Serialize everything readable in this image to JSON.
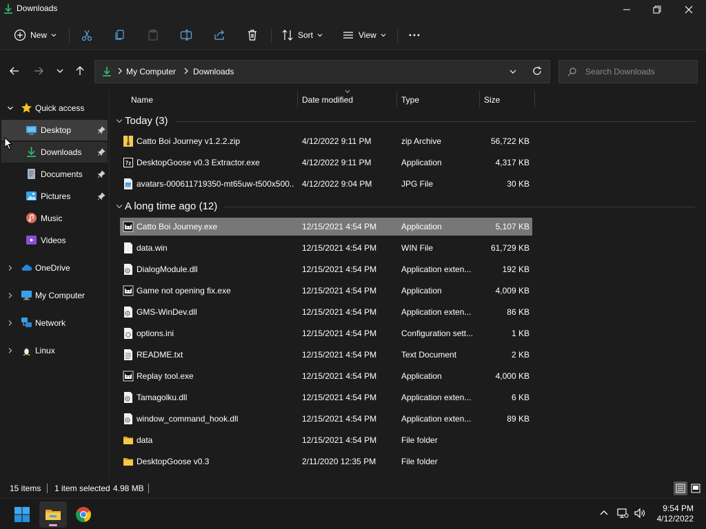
{
  "window": {
    "title": "Downloads",
    "icon": "download-arrow-icon",
    "controls": [
      "minimize-icon",
      "restore-icon",
      "close-icon"
    ]
  },
  "commandbar": {
    "new_label": "New",
    "sort_label": "Sort",
    "view_label": "View",
    "icons": [
      "cut-icon",
      "copy-icon",
      "paste-icon",
      "rename-icon",
      "share-icon",
      "delete-icon",
      "more-icon"
    ]
  },
  "address": {
    "crumbs": [
      "My Computer",
      "Downloads"
    ],
    "search_placeholder": "Search Downloads"
  },
  "sidebar": {
    "items": [
      {
        "label": "Quick access",
        "icon": "star-icon"
      },
      {
        "label": "Desktop",
        "icon": "desktop-icon",
        "pinned": true
      },
      {
        "label": "Downloads",
        "icon": "downloads-icon",
        "pinned": true
      },
      {
        "label": "Documents",
        "icon": "documents-icon",
        "pinned": true
      },
      {
        "label": "Pictures",
        "icon": "pictures-icon",
        "pinned": true
      },
      {
        "label": "Music",
        "icon": "music-icon"
      },
      {
        "label": "Videos",
        "icon": "videos-icon"
      },
      {
        "label": "OneDrive",
        "icon": "cloud-icon"
      },
      {
        "label": "My Computer",
        "icon": "monitor-icon"
      },
      {
        "label": "Network",
        "icon": "network-icon"
      },
      {
        "label": "Linux",
        "icon": "penguin-icon"
      }
    ]
  },
  "columns": {
    "name": "Name",
    "date": "Date modified",
    "type": "Type",
    "size": "Size"
  },
  "groups": [
    {
      "label": "Today (3)",
      "files": [
        {
          "name": "Catto Boi Journey v1.2.2.zip",
          "date": "4/12/2022 9:11 PM",
          "type": "zip Archive",
          "size": "56,722 KB",
          "icon": "zip-icon"
        },
        {
          "name": "DesktopGoose v0.3 Extractor.exe",
          "date": "4/12/2022 9:11 PM",
          "type": "Application",
          "size": "4,317 KB",
          "icon": "7z-icon"
        },
        {
          "name": "avatars-000611719350-mt65uw-t500x500....",
          "date": "4/12/2022 9:04 PM",
          "type": "JPG File",
          "size": "30 KB",
          "icon": "image-file-icon"
        }
      ]
    },
    {
      "label": "A long time ago (12)",
      "files": [
        {
          "name": "Catto Boi Journey.exe",
          "date": "12/15/2021 4:54 PM",
          "type": "Application",
          "size": "5,107 KB",
          "icon": "cat-app-icon",
          "selected": true
        },
        {
          "name": "data.win",
          "date": "12/15/2021 4:54 PM",
          "type": "WIN File",
          "size": "61,729 KB",
          "icon": "blank-file-icon"
        },
        {
          "name": "DialogModule.dll",
          "date": "12/15/2021 4:54 PM",
          "type": "Application exten...",
          "size": "192 KB",
          "icon": "dll-file-icon"
        },
        {
          "name": "Game not opening fix.exe",
          "date": "12/15/2021 4:54 PM",
          "type": "Application",
          "size": "4,009 KB",
          "icon": "cat-app-icon"
        },
        {
          "name": "GMS-WinDev.dll",
          "date": "12/15/2021 4:54 PM",
          "type": "Application exten...",
          "size": "86 KB",
          "icon": "dll-file-icon"
        },
        {
          "name": "options.ini",
          "date": "12/15/2021 4:54 PM",
          "type": "Configuration sett...",
          "size": "1 KB",
          "icon": "config-file-icon"
        },
        {
          "name": "README.txt",
          "date": "12/15/2021 4:54 PM",
          "type": "Text Document",
          "size": "2 KB",
          "icon": "text-file-icon"
        },
        {
          "name": "Replay tool.exe",
          "date": "12/15/2021 4:54 PM",
          "type": "Application",
          "size": "4,000 KB",
          "icon": "cat-app-icon"
        },
        {
          "name": "Tamagolku.dll",
          "date": "12/15/2021 4:54 PM",
          "type": "Application exten...",
          "size": "6 KB",
          "icon": "dll-file-icon"
        },
        {
          "name": "window_command_hook.dll",
          "date": "12/15/2021 4:54 PM",
          "type": "Application exten...",
          "size": "89 KB",
          "icon": "dll-file-icon"
        },
        {
          "name": "data",
          "date": "12/15/2021 4:54 PM",
          "type": "File folder",
          "size": "",
          "icon": "folder-icon"
        },
        {
          "name": "DesktopGoose v0.3",
          "date": "2/11/2020 12:35 PM",
          "type": "File folder",
          "size": "",
          "icon": "folder-icon"
        }
      ]
    }
  ],
  "status": {
    "count": "15 items",
    "selection": "1 item selected",
    "selection_size": "4.98 MB"
  },
  "taskbar": {
    "apps": [
      "windows-start-icon",
      "file-explorer-icon",
      "chrome-icon"
    ],
    "tray": [
      "chevron-up-icon",
      "network-icon",
      "volume-icon"
    ],
    "time": "9:54 PM",
    "date": "4/12/2022"
  },
  "colors": {
    "accent": "#33b36b",
    "selected_row": "#777777",
    "sidebar_selected": "#3d3d3d",
    "folder": "#f3c14b"
  }
}
